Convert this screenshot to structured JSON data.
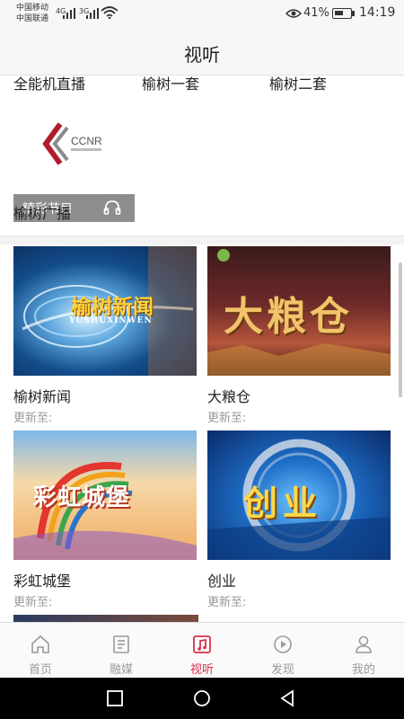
{
  "status": {
    "carrier1": "中国移动",
    "carrier2": "中国联通",
    "net1": "4G",
    "net2": "3G",
    "battery": "41%",
    "time": "14:19"
  },
  "header": {
    "title": "视听"
  },
  "radio": {
    "channels": [
      "全能机直播",
      "榆树一套",
      "榆树二套"
    ],
    "card": {
      "logo_text": "CCNR",
      "overlay_label": "精彩节目",
      "name": "榆树广播"
    }
  },
  "programs": [
    {
      "title": "榆树新闻",
      "updated": "更新至:",
      "art_text": "榆树新闻",
      "art_sub": "YUSHUXINWEN"
    },
    {
      "title": "大粮仓",
      "updated": "更新至:",
      "art_text": "大粮仓"
    },
    {
      "title": "彩虹城堡",
      "updated": "更新至:",
      "art_text": "彩虹城堡"
    },
    {
      "title": "创业",
      "updated": "更新至:",
      "art_text": "创业"
    }
  ],
  "tabs": [
    {
      "label": "首页",
      "icon": "home-icon"
    },
    {
      "label": "融媒",
      "icon": "document-icon"
    },
    {
      "label": "视听",
      "icon": "media-icon",
      "active": true
    },
    {
      "label": "发现",
      "icon": "play-circle-icon"
    },
    {
      "label": "我的",
      "icon": "user-icon"
    }
  ],
  "colors": {
    "accent": "#d9304a",
    "inactive": "#9a9a9a"
  }
}
